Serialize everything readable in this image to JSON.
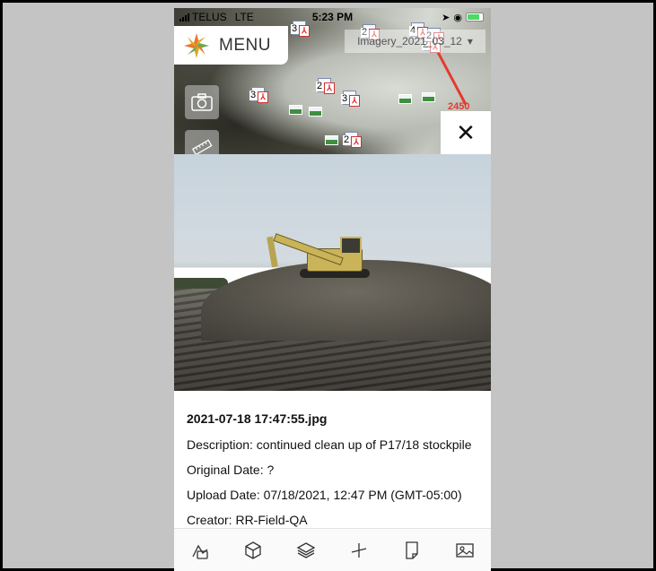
{
  "status_bar": {
    "carrier": "TELUS",
    "network": "LTE",
    "time": "5:23 PM"
  },
  "map": {
    "menu_label": "MENU",
    "imagery_dropdown": "Imagery_2021_03_12",
    "marker_counts": [
      "3",
      "2",
      "4",
      "2",
      "3",
      "2",
      "3",
      "2",
      "2"
    ],
    "red_label": "2450",
    "close_glyph": "✕"
  },
  "photo_info": {
    "filename": "2021-07-18 17:47:55.jpg",
    "description": "Description: continued clean up of P17/18 stockpile",
    "original_date": "Original Date: ?",
    "upload_date": "Upload Date: 07/18/2021, 12:47 PM (GMT-05:00)",
    "creator": "Creator: RR-Field-QA"
  },
  "toolbar": {
    "icons": [
      "measure-tool-icon",
      "cube-3d-icon",
      "layers-icon",
      "axis-tool-icon",
      "document-icon",
      "image-icon"
    ]
  },
  "colors": {
    "logo_orange": "#e8772e",
    "logo_green": "#6aa84f",
    "logo_gold": "#d9a826",
    "accent_red": "#e53a2f"
  }
}
